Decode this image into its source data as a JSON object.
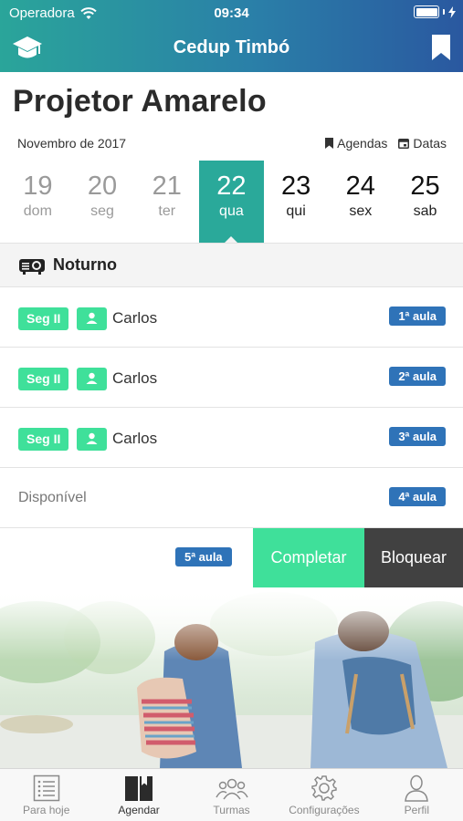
{
  "status_bar": {
    "carrier": "Operadora",
    "time": "09:34"
  },
  "nav": {
    "title": "Cedup Timbó",
    "left_icon": "graduation-cap-icon",
    "right_icon": "bookmark-icon"
  },
  "page": {
    "title": "Projetor Amarelo",
    "month": "Novembro de 2017",
    "links": {
      "agendas": "Agendas",
      "datas": "Datas"
    }
  },
  "week": [
    {
      "num": "19",
      "wd": "dom",
      "state": "past"
    },
    {
      "num": "20",
      "wd": "seg",
      "state": "past"
    },
    {
      "num": "21",
      "wd": "ter",
      "state": "past"
    },
    {
      "num": "22",
      "wd": "qua",
      "state": "active"
    },
    {
      "num": "23",
      "wd": "qui",
      "state": "future"
    },
    {
      "num": "24",
      "wd": "sex",
      "state": "future"
    },
    {
      "num": "25",
      "wd": "sab",
      "state": "future"
    }
  ],
  "section": {
    "label": "Noturno",
    "icon": "projector-icon"
  },
  "slots": [
    {
      "tag": "Seg II",
      "name": "Carlos",
      "badge": "1ª aula"
    },
    {
      "tag": "Seg II",
      "name": "Carlos",
      "badge": "2ª aula"
    },
    {
      "tag": "Seg II",
      "name": "Carlos",
      "badge": "3ª aula"
    },
    {
      "available": "Disponível",
      "badge": "4ª aula"
    },
    {
      "badge": "5ª aula",
      "complete": "Completar",
      "block": "Bloquear"
    }
  ],
  "colors": {
    "accent": "#2aa99a",
    "tag_green": "#3fe09a",
    "badge_blue": "#2f73b8",
    "block_dark": "#414141"
  },
  "tabs": [
    {
      "label": "Para hoje",
      "icon": "list-icon"
    },
    {
      "label": "Agendar",
      "icon": "book-icon",
      "active": true
    },
    {
      "label": "Turmas",
      "icon": "group-icon"
    },
    {
      "label": "Configurações",
      "icon": "gear-icon"
    },
    {
      "label": "Perfil",
      "icon": "person-icon"
    }
  ]
}
